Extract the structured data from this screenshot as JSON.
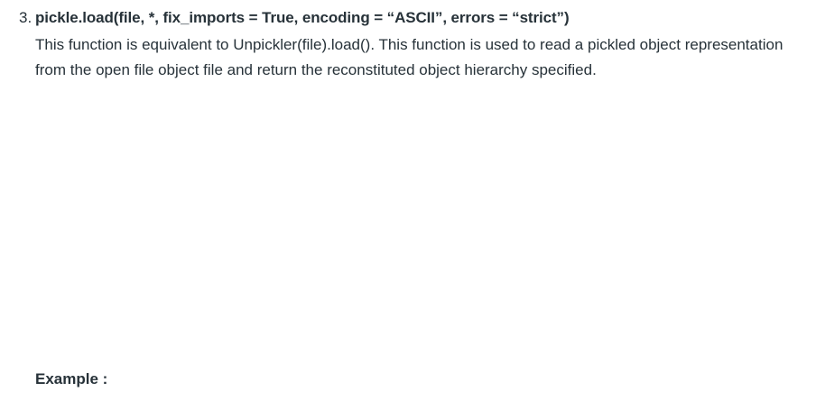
{
  "item": {
    "number": "3.",
    "signature": "pickle.load(file, *, fix_imports = True, encoding = “ASCII”, errors = “strict”)",
    "description": "This function is equivalent to Unpickler(file).load(). This function is used to read a pickled object representation from the open file object file and return the reconstituted object hierarchy specified."
  },
  "example": {
    "label": "Example :"
  }
}
